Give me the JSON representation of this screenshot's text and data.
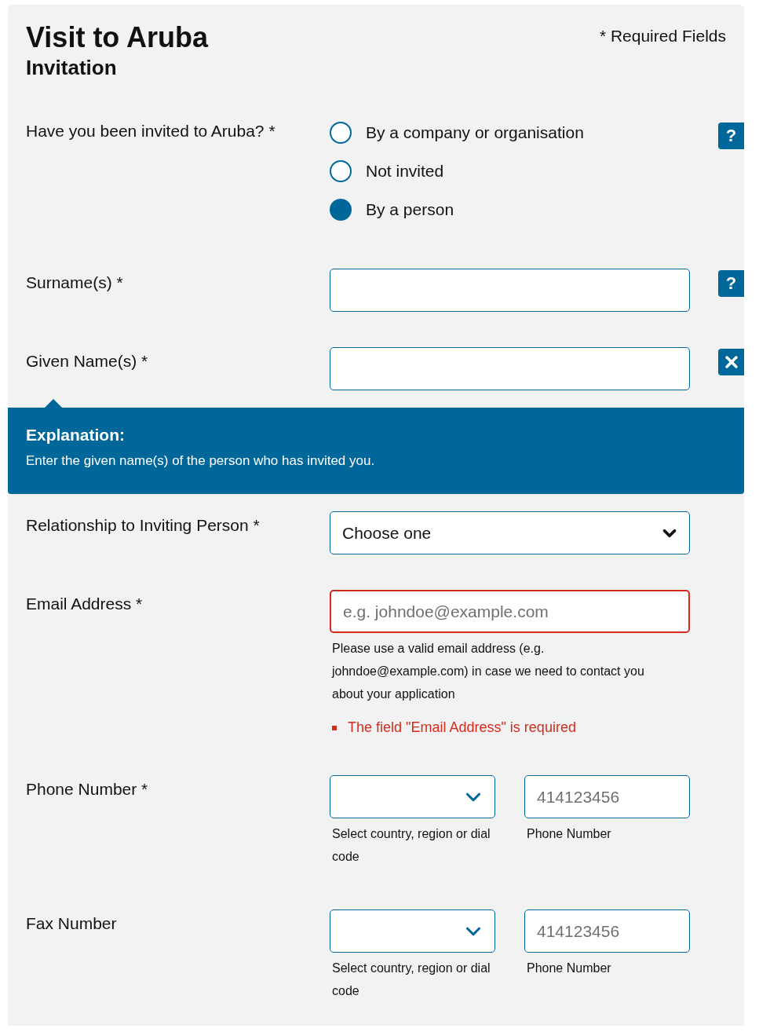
{
  "header": {
    "title": "Visit to Aruba",
    "subtitle": "Invitation",
    "required_note": "* Required Fields"
  },
  "fields": [
    {
      "kind": "radio",
      "label": "Have you been invited to Aruba? *",
      "options": [
        {
          "label": "By a company or organisation",
          "selected": false
        },
        {
          "label": "Not invited",
          "selected": false
        },
        {
          "label": "By a person",
          "selected": true
        }
      ],
      "help": {
        "kind": "question",
        "label": "?"
      }
    },
    {
      "kind": "text",
      "label": "Surname(s) *",
      "help": {
        "kind": "question",
        "label": "?"
      }
    },
    {
      "kind": "text",
      "label": "Given Name(s) *",
      "help": {
        "kind": "close"
      },
      "explanation": {
        "title": "Explanation:",
        "text": "Enter the given name(s) of the person who has invited you."
      }
    },
    {
      "kind": "select",
      "label": "Relationship to Inviting Person *",
      "value": "Choose one"
    },
    {
      "kind": "email",
      "label": "Email Address *",
      "placeholder": "e.g. johndoe@example.com",
      "invalid": true,
      "hint": "Please use a valid email address (e.g. johndoe@example.com) in case we need to contact you about your application",
      "error": "The field \"Email Address\" is required"
    },
    {
      "kind": "phone",
      "label": "Phone Number *",
      "code_hint": "Select country, region or dial code",
      "number_placeholder": "414123456",
      "number_hint": "Phone Number"
    },
    {
      "kind": "phone",
      "label": "Fax Number",
      "code_hint": "Select country, region or dial code",
      "number_placeholder": "414123456",
      "number_hint": "Phone Number"
    }
  ]
}
